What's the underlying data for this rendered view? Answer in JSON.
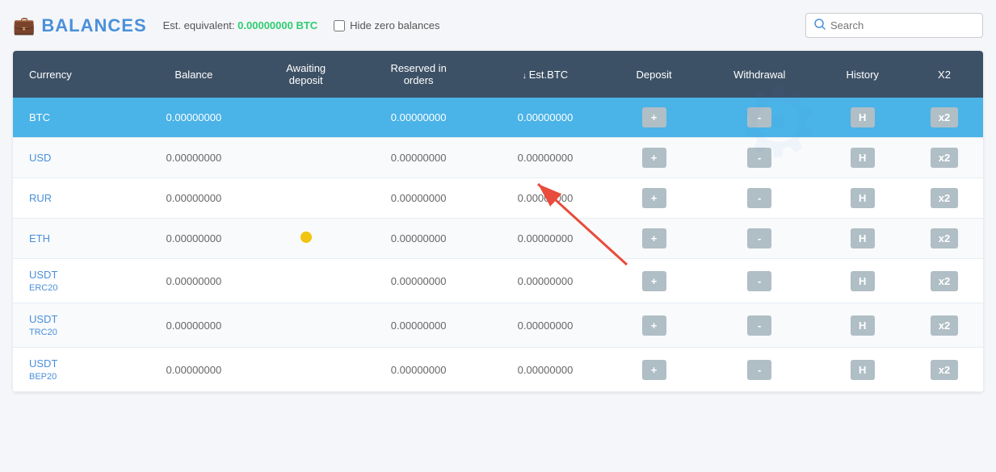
{
  "header": {
    "icon": "💼",
    "title": "BALANCES",
    "est_label": "Est. equivalent:",
    "est_value": "0.00000000 BTC",
    "hide_zero_label": "Hide zero balances",
    "search_placeholder": "Search"
  },
  "table": {
    "columns": [
      "Currency",
      "Balance",
      "Awaiting deposit",
      "Reserved in orders",
      "Est.BTC",
      "Deposit",
      "Withdrawal",
      "History",
      "X2"
    ],
    "rows": [
      {
        "currency": "BTC",
        "currency_sub": "",
        "balance": "0.00000000",
        "awaiting": "",
        "reserved": "0.00000000",
        "estbtc": "0.00000000",
        "deposit": "+",
        "withdrawal": "-",
        "history": "H",
        "x2": "x2",
        "highlighted": true,
        "has_dot": false
      },
      {
        "currency": "USD",
        "currency_sub": "",
        "balance": "0.00000000",
        "awaiting": "",
        "reserved": "0.00000000",
        "estbtc": "0.00000000",
        "deposit": "+",
        "withdrawal": "-",
        "history": "H",
        "x2": "x2",
        "highlighted": false,
        "has_dot": false
      },
      {
        "currency": "RUR",
        "currency_sub": "",
        "balance": "0.00000000",
        "awaiting": "",
        "reserved": "0.00000000",
        "estbtc": "0.00000000",
        "deposit": "+",
        "withdrawal": "-",
        "history": "H",
        "x2": "x2",
        "highlighted": false,
        "has_dot": false
      },
      {
        "currency": "ETH",
        "currency_sub": "",
        "balance": "0.00000000",
        "awaiting": "",
        "reserved": "0.00000000",
        "estbtc": "0.00000000",
        "deposit": "+",
        "withdrawal": "-",
        "history": "H",
        "x2": "x2",
        "highlighted": false,
        "has_dot": true
      },
      {
        "currency": "USDT",
        "currency_sub": "ERC20",
        "balance": "0.00000000",
        "awaiting": "",
        "reserved": "0.00000000",
        "estbtc": "0.00000000",
        "deposit": "+",
        "withdrawal": "-",
        "history": "H",
        "x2": "x2",
        "highlighted": false,
        "has_dot": false
      },
      {
        "currency": "USDT",
        "currency_sub": "TRC20",
        "balance": "0.00000000",
        "awaiting": "",
        "reserved": "0.00000000",
        "estbtc": "0.00000000",
        "deposit": "+",
        "withdrawal": "-",
        "history": "H",
        "x2": "x2",
        "highlighted": false,
        "has_dot": false
      },
      {
        "currency": "USDT",
        "currency_sub": "BEP20",
        "balance": "0.00000000",
        "awaiting": "",
        "reserved": "0.00000000",
        "estbtc": "0.00000000",
        "deposit": "+",
        "withdrawal": "-",
        "history": "H",
        "x2": "x2",
        "highlighted": false,
        "has_dot": false
      }
    ]
  },
  "colors": {
    "header_bg": "#3d5166",
    "highlight_row": "#4ab3e8",
    "accent_blue": "#4a90d9",
    "btn_gray": "#b0bec5",
    "est_green": "#2ecc71"
  }
}
